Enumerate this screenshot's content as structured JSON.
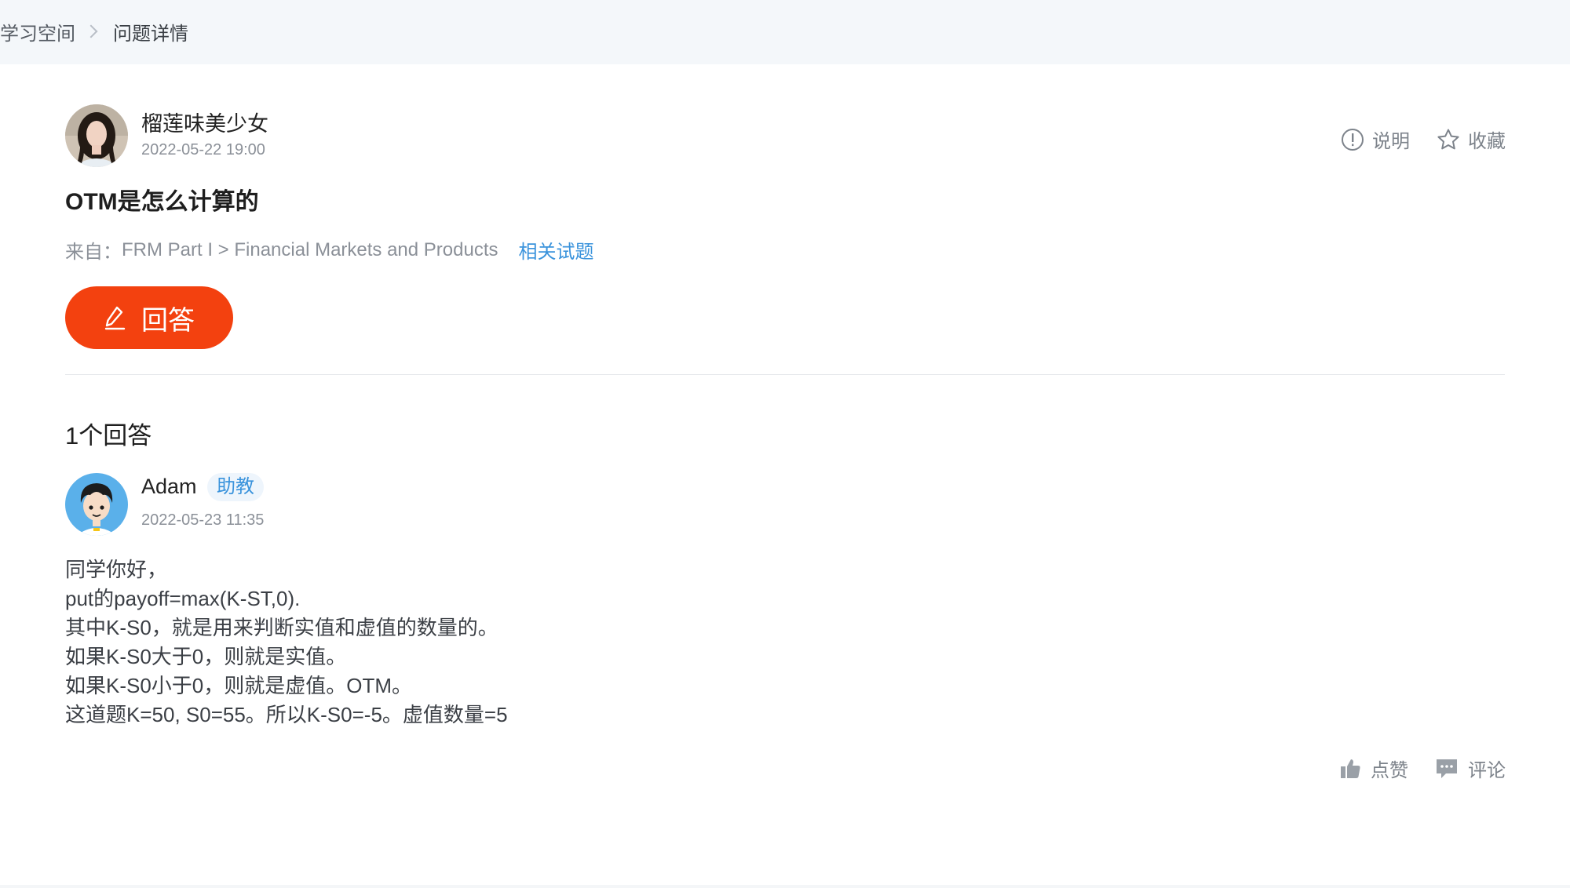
{
  "breadcrumb": {
    "root": "学习空间",
    "current": "问题详情"
  },
  "question": {
    "author": "榴莲味美少女",
    "time": "2022-05-22 19:00",
    "title": "OTM是怎么计算的",
    "source_prefix": "来自：",
    "source_path": "FRM Part I > Financial Markets and Products",
    "related_link": "相关试题",
    "actions": {
      "explain": "说明",
      "favorite": "收藏"
    },
    "answer_button": "回答"
  },
  "answers_count": "1个回答",
  "answer": {
    "author": "Adam",
    "role": "助教",
    "time": "2022-05-23 11:35",
    "lines": [
      "同学你好，",
      "put的payoff=max(K-ST,0).",
      "其中K-S0，就是用来判断实值和虚值的数量的。",
      "如果K-S0大于0，则就是实值。",
      "如果K-S0小于0，则就是虚值。OTM。",
      "这道题K=50, S0=55。所以K-S0=-5。虚值数量=5"
    ],
    "actions": {
      "like": "点赞",
      "comment": "评论"
    }
  },
  "icons": {
    "breadcrumb_separator": "chevron-right-icon",
    "explain": "exclamation-circle-icon",
    "favorite": "star-icon",
    "answer": "pencil-icon",
    "like": "thumbs-up-icon",
    "comment": "comment-icon"
  },
  "colors": {
    "accent": "#f3410f",
    "link": "#3a93dc",
    "breadcrumb_bg": "#f4f7fa",
    "muted_text": "#8b9098"
  }
}
